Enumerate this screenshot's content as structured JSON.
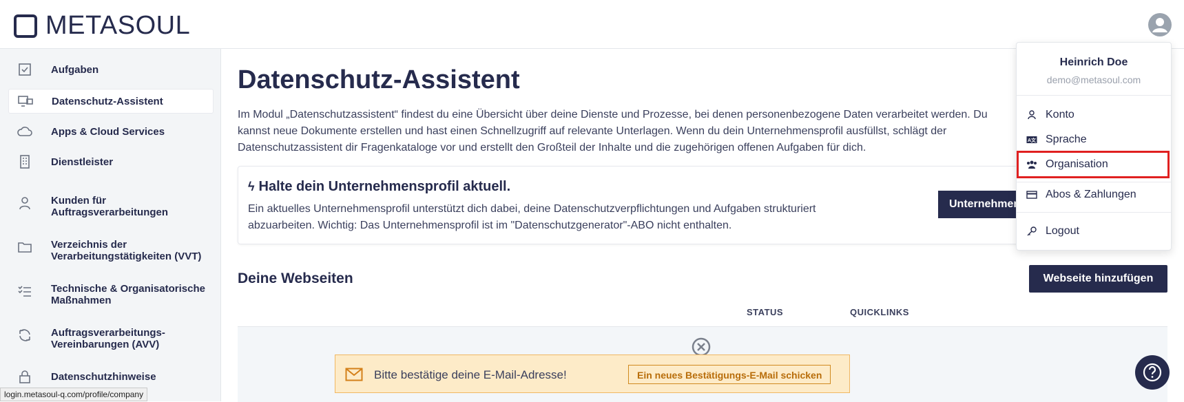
{
  "header": {
    "logo_text": "METASOUL",
    "avatar_icon": "user-circle-icon"
  },
  "sidebar": {
    "items": [
      {
        "label": "Aufgaben",
        "icon": "checkbox-icon"
      },
      {
        "label": "Datenschutz-Assistent",
        "icon": "monitor-chat-icon",
        "active": true
      },
      {
        "label": "Apps & Cloud Services",
        "icon": "cloud-icon"
      },
      {
        "label": "Dienstleister",
        "icon": "building-icon"
      },
      {
        "label": "Kunden für Auftragsverarbeitungen",
        "icon": "user-icon"
      },
      {
        "label": "Verzeichnis der Verarbeitungstätigkeiten (VVT)",
        "icon": "folder-icon"
      },
      {
        "label": "Technische & Organisatorische Maßnahmen",
        "icon": "checklist-icon"
      },
      {
        "label": "Auftragsverarbeitungs-Vereinbarungen (AVV)",
        "icon": "refresh-icon"
      },
      {
        "label": "Datenschutzhinweise",
        "icon": "lock-icon"
      }
    ]
  },
  "main": {
    "title": "Datenschutz-Assistent",
    "intro": "Im Modul „Datenschutzassistent“ findest du eine Übersicht über deine Dienste und Prozesse, bei denen personenbezogene Daten verarbeitet werden. Du kannst neue Dokumente erstellen und hast einen Schnellzugriff auf relevante Unterlagen. Wenn du dein Unternehmensprofil ausfüllst, schlägt der Datenschutzassistent dir Fragenkataloge vor und erstellt den Großteil der Inhalte und die zugehörigen offenen Aufgaben für dich.",
    "profile_card": {
      "title": "Halte dein Unternehmensprofil aktuell.",
      "text": "Ein aktuelles Unternehmensprofil unterstützt dich dabei, deine Datenschutzverpflichtungen und Aufgaben strukturiert abzuarbeiten. Wichtig: Das Unternehmensprofil ist im \"Datenschutzgenerator\"-ABO nicht enthalten.",
      "button_label": "Unternehmensprofil"
    },
    "websites": {
      "title": "Deine Webseiten",
      "add_button": "Webseite hinzufügen",
      "columns": [
        "STATUS",
        "QUICKLINKS"
      ]
    }
  },
  "banner": {
    "message": "Bitte bestätige deine E-Mail-Adresse!",
    "resend_button": "Ein neues Bestätigungs-E-Mail schicken",
    "icon": "mail-icon",
    "color": "#fdebc8"
  },
  "help": {
    "label": "?"
  },
  "status_bar": {
    "url": "login.metasoul-q.com/profile/company"
  },
  "dropdown": {
    "name": "Heinrich Doe",
    "email": "demo@metasoul.com",
    "items": [
      {
        "label": "Konto",
        "icon": "user-icon"
      },
      {
        "label": "Sprache",
        "icon": "language-icon"
      },
      {
        "label": "Organisation",
        "icon": "users-icon",
        "highlighted": true
      },
      {
        "label": "Abos & Zahlungen",
        "icon": "credit-card-icon"
      },
      {
        "label": "Logout",
        "icon": "key-icon"
      }
    ]
  },
  "colors": {
    "brand": "#262b4d",
    "highlight": "#e02020"
  }
}
